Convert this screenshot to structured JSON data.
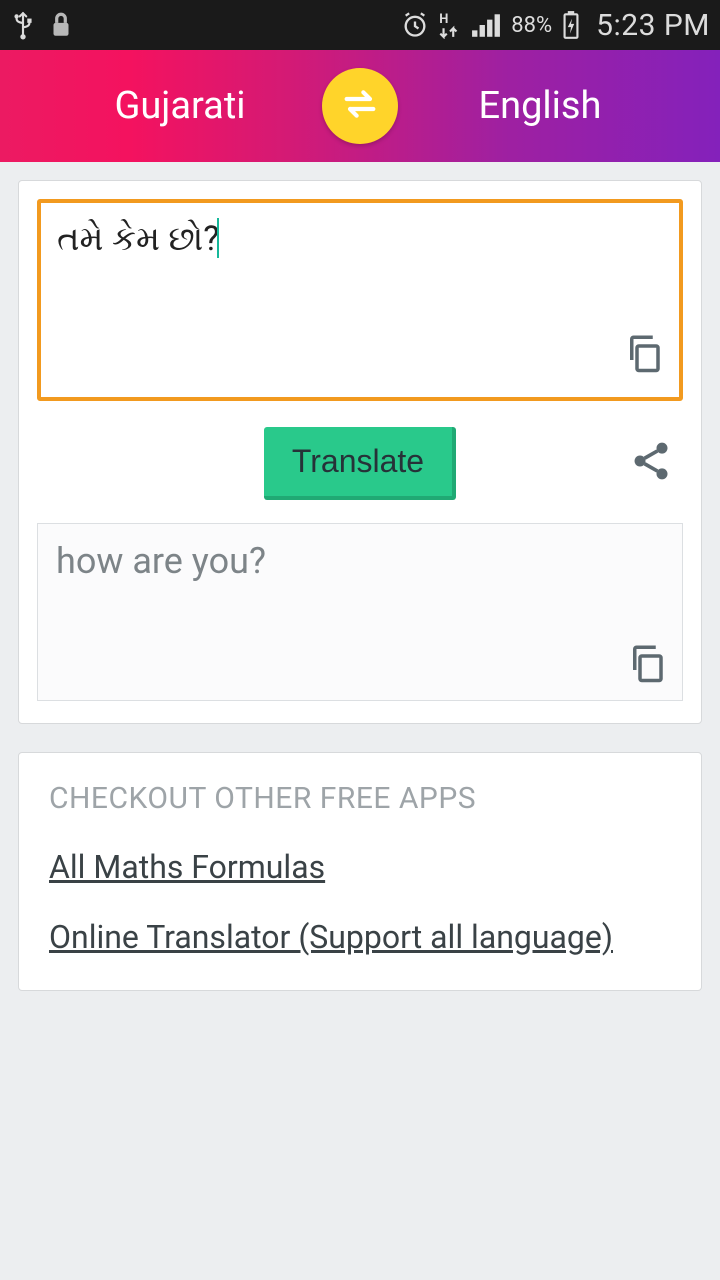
{
  "status": {
    "battery": "88%",
    "time": "5:23 PM"
  },
  "header": {
    "source_lang": "Gujarati",
    "target_lang": "English"
  },
  "input": {
    "text": "તમે કેમ છો?"
  },
  "actions": {
    "translate_label": "Translate"
  },
  "output": {
    "text": "how are you?"
  },
  "other": {
    "title": "CHECKOUT OTHER FREE APPS",
    "links": [
      "All Maths Formulas",
      "Online Translator (Support all language)"
    ]
  }
}
